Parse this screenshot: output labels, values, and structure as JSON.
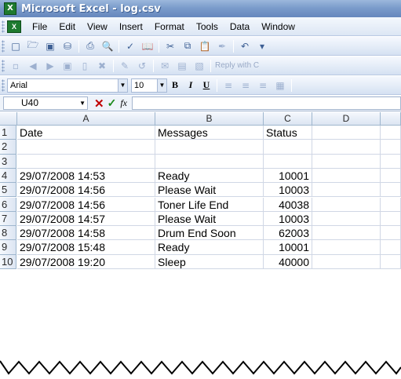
{
  "window": {
    "title": "Microsoft Excel - log.csv"
  },
  "menubar": {
    "items": [
      {
        "label": "File"
      },
      {
        "label": "Edit"
      },
      {
        "label": "View"
      },
      {
        "label": "Insert"
      },
      {
        "label": "Format"
      },
      {
        "label": "Tools"
      },
      {
        "label": "Data"
      },
      {
        "label": "Window"
      }
    ]
  },
  "toolbar2": {
    "reply_label": "Reply with C"
  },
  "format_bar": {
    "font_name": "Arial",
    "font_size": "10",
    "bold_label": "B",
    "italic_label": "I",
    "underline_label": "U"
  },
  "formula_bar": {
    "name_box": "U40",
    "fx_label": "fx",
    "value": ""
  },
  "sheet": {
    "columns": [
      "A",
      "B",
      "C",
      "D"
    ],
    "row_numbers": [
      "1",
      "2",
      "3",
      "4",
      "5",
      "6",
      "7",
      "8",
      "9",
      "10"
    ],
    "rows": [
      [
        "Date",
        "Messages",
        "Status",
        ""
      ],
      [
        "",
        "",
        "",
        ""
      ],
      [
        "",
        "",
        "",
        ""
      ],
      [
        "29/07/2008 14:53",
        "Ready",
        "10001",
        ""
      ],
      [
        "29/07/2008 14:56",
        "Please Wait",
        "10003",
        ""
      ],
      [
        "29/07/2008 14:56",
        "Toner Life End",
        "40038",
        ""
      ],
      [
        "29/07/2008 14:57",
        "Please Wait",
        "10003",
        ""
      ],
      [
        "29/07/2008 14:58",
        "Drum End Soon",
        "62003",
        ""
      ],
      [
        "29/07/2008 15:48",
        "Ready",
        "10001",
        ""
      ],
      [
        "29/07/2008 19:20",
        "Sleep",
        "40000",
        ""
      ]
    ]
  }
}
